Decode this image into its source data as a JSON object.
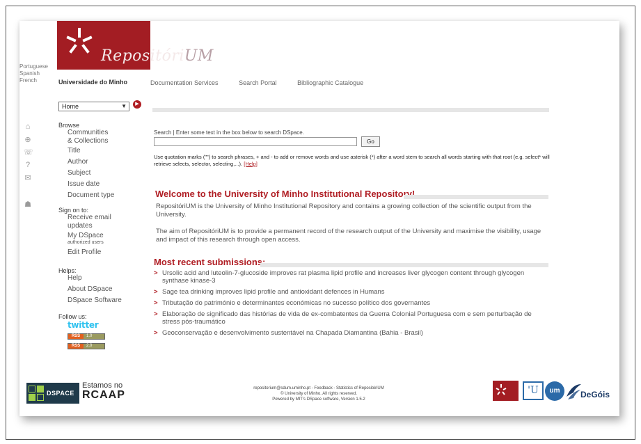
{
  "header": {
    "logo_text_main": "Repositóri",
    "logo_text_tail": "UM",
    "languages": [
      "Portuguese",
      "Spanish",
      "French"
    ],
    "university": "Universidade do Minho",
    "nav": [
      "Documentation Services",
      "Search Portal",
      "Bibliographic Catalogue"
    ]
  },
  "sidebar": {
    "select_value": "Home",
    "browse_title": "Browse",
    "browse_items": [
      "Communities",
      "& Collections",
      "Title",
      "Author",
      "Subject",
      "Issue date",
      "Document type"
    ],
    "signon_title": "Sign on to:",
    "signon_items": [
      "Receive email",
      "updates",
      "My DSpace",
      "authorized users",
      "Edit Profile"
    ],
    "helps_title": "Helps:",
    "helps_items": [
      "Help",
      "About DSpace",
      "DSpace Software"
    ],
    "follow_title": "Follow us:",
    "twitter": "twitter",
    "rss": [
      {
        "label": "RSS",
        "version": "1.0"
      },
      {
        "label": "RSS",
        "version": "2.0"
      }
    ]
  },
  "search": {
    "label": "Search | Enter some text in the box below to search DSpace.",
    "value": "",
    "go_label": "Go",
    "help_text": "Use quotation marks (\"\") to search phrases, + and - to add or remove words and use asterisk (*) after a word stem to search all words starting with that root (e.g. select* will retrieve selects, selector, selecting,...).",
    "help_link": "[Help]"
  },
  "welcome": {
    "title": "Welcome to the University of Minho Institutional Repository!",
    "p1": "RepositóriUM is the University of Minho Institutional Repository and contains a growing collection of the scientific output from the University.",
    "p2": "The aim of RepositóriUM is to provide a permanent record of the research output of the University and maximise the visibility, usage and impact of this research through open access."
  },
  "recent": {
    "title": "Most recent submissions:",
    "items": [
      "Ursolic acid and luteolin-7-glucoside improves rat plasma lipid profile and increases liver glycogen content through glycogen synthase kinase-3",
      "Sage tea drinking improves lipid profile and antioxidant defences in Humans",
      "Tributação do património e determinantes económicas no sucesso político dos governantes",
      "Elaboração de significado das histórias de vida de ex-combatentes da Guerra Colonial Portuguesa com e sem perturbação de stress pós-traumático",
      "Geoconservação e desenvolvimento sustentável na Chapada Diamantina (Bahia - Brasil)"
    ]
  },
  "footer": {
    "dspace": "DSPACE",
    "estamos": "Estamos no",
    "rcaap": "RCAAP",
    "line1": "repositorium@sdum.uminho.pt - Feedback - Statistics of RepositóriUM",
    "line2": "© University of Minho. All rights reserved.",
    "line3": "Powered by MIT's DSpace software, Version 1.5.2",
    "u_logo": "'U",
    "um_logo": "um",
    "degois": "DeGóis"
  },
  "colors": {
    "brand_red": "#a31d23",
    "link_red": "#b01e24",
    "twitter_blue": "#2fc2ef"
  }
}
